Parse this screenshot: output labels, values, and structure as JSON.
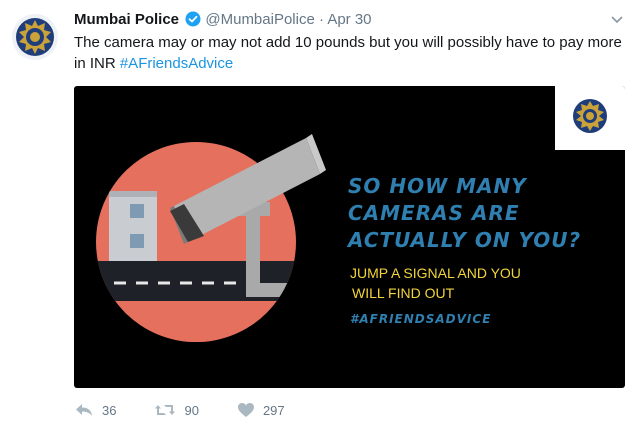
{
  "tweet": {
    "name": "Mumbai Police",
    "handle": "@MumbaiPolice",
    "separator": "·",
    "date": "Apr 30",
    "text": "The camera may or may not add 10 pounds but you will possibly have to pay more in INR ",
    "hashtag": "#AFriendsAdvice"
  },
  "image": {
    "headline_lines": [
      "SO HOW MANY",
      "CAMERAS ARE",
      "ACTUALLY ON YOU?"
    ],
    "subtext_lines": [
      "JUMP A SIGNAL AND YOU",
      "WILL FIND OUT"
    ],
    "hashtag": "#AFRIENDSADVICE",
    "colors": {
      "headline": "#2f7fb0",
      "subtext": "#f2d43d",
      "circle": "#e5705d",
      "road": "#1e2127",
      "camera": "#a9a9a9"
    }
  },
  "actions": {
    "reply_count": "36",
    "retweet_count": "90",
    "like_count": "297"
  },
  "icons": [
    "police-badge-icon",
    "verified-badge-icon",
    "caret-down-icon",
    "reply-icon",
    "retweet-icon",
    "heart-icon"
  ],
  "colors": {
    "hashtag": "#1b95e0",
    "verified": "#1da1f2",
    "muted": "#657786"
  }
}
